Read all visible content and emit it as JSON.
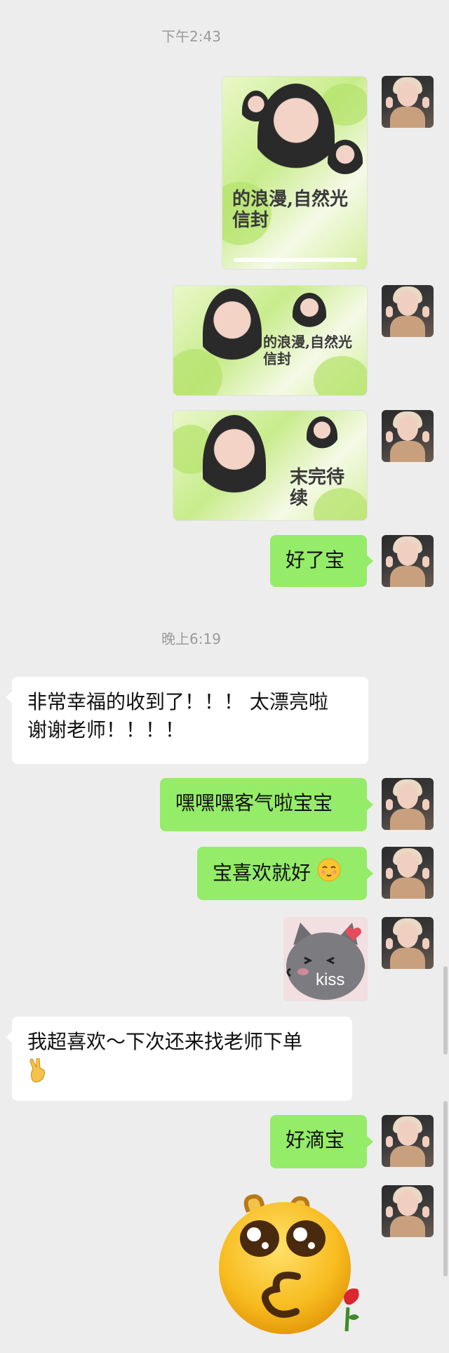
{
  "timestamps": [
    "下午2:43",
    "晚上6:19"
  ],
  "images": {
    "image1": {
      "title": "的浪漫,自然光信封"
    },
    "image2": {
      "title": "的浪漫,自然光信封"
    },
    "image3": {
      "title": "末完待续"
    }
  },
  "messages": [
    {
      "from": "me",
      "text": "好了宝"
    },
    {
      "from": "other",
      "line1": "非常幸福的收到了！！！ 太漂亮啦",
      "line2": "谢谢老师！！！！"
    },
    {
      "from": "me",
      "text": "嘿嘿嘿客气啦宝宝"
    },
    {
      "from": "me",
      "text": "宝喜欢就好"
    },
    {
      "from": "me",
      "sticker_text": "kiss"
    },
    {
      "from": "other",
      "line1": "我超喜欢～下次还来找老师下单"
    },
    {
      "from": "me",
      "text": "好滴宝"
    }
  ],
  "colors": {
    "background": "#ededed",
    "my_bubble": "#95ec69",
    "their_bubble": "#ffffff",
    "timestamp_text": "#9a9a9a"
  },
  "icons": {
    "blush_emoji": "blush-emoji-icon",
    "victory_emoji": "victory-hand-icon",
    "big_emoji": "kissing-emoji-with-rose-icon"
  }
}
